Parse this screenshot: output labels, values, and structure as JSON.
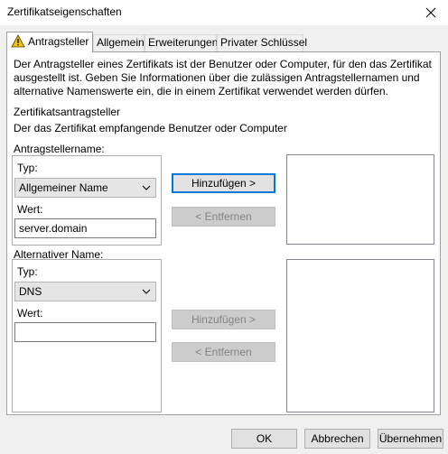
{
  "window": {
    "title": "Zertifikatseigenschaften",
    "close_symbol": "✕"
  },
  "tabs": [
    {
      "label": "Antragsteller",
      "active": true,
      "icon": "warning-icon"
    },
    {
      "label": "Allgemein"
    },
    {
      "label": "Erweiterungen"
    },
    {
      "label": "Privater Schlüssel"
    }
  ],
  "panel": {
    "description_lines": [
      "Der Antragsteller eines Zertifikats ist der Benutzer oder Computer, für den das Zertifikat",
      "ausgestellt ist. Geben Sie Informationen über die zulässigen Antragstellernamen und",
      "alternative Namenswerte ein, die in einem Zertifikat verwendet werden dürfen."
    ],
    "section_title": "Zertifikatsantragsteller",
    "section_subtitle": "Der das Zertifikat empfangende Benutzer oder Computer"
  },
  "subject_name": {
    "label": "Antragstellername:",
    "type_label": "Typ:",
    "type_value": "Allgemeiner Name",
    "value_label": "Wert:",
    "value": "server.domain",
    "add_button": "Hinzufügen >",
    "remove_button": "< Entfernen"
  },
  "alt_name": {
    "label": "Alternativer Name:",
    "type_label": "Typ:",
    "type_value": "DNS",
    "value_label": "Wert:",
    "value": "",
    "add_button": "Hinzufügen >",
    "remove_button": "< Entfernen"
  },
  "footer": {
    "ok": "OK",
    "cancel": "Abbrechen",
    "apply": "Übernehmen"
  },
  "colors": {
    "warning": "#f5c400",
    "focus_border": "#0078d7"
  }
}
